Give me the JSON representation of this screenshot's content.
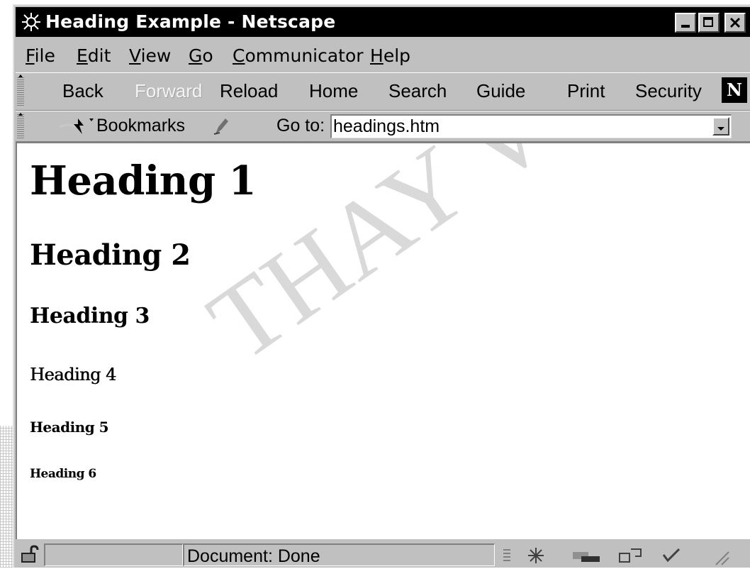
{
  "window": {
    "title": "Heading Example - Netscape"
  },
  "menu": [
    "File",
    "Edit",
    "View",
    "Go",
    "Communicator",
    "Help"
  ],
  "toolbar": {
    "back": "Back",
    "forward": "Forward",
    "reload": "Reload",
    "home": "Home",
    "search": "Search",
    "guide": "Guide",
    "print": "Print",
    "security": "Security",
    "logo": "N"
  },
  "location": {
    "bookmarks": "Bookmarks",
    "goto_label": "Go to:",
    "url": "headings.htm"
  },
  "content": {
    "headings": [
      "Heading 1",
      "Heading 2",
      "Heading 3",
      "Heading 4",
      "Heading 5",
      "Heading 6"
    ],
    "watermark": "THAY VU"
  },
  "status": {
    "text": "Document: Done"
  }
}
